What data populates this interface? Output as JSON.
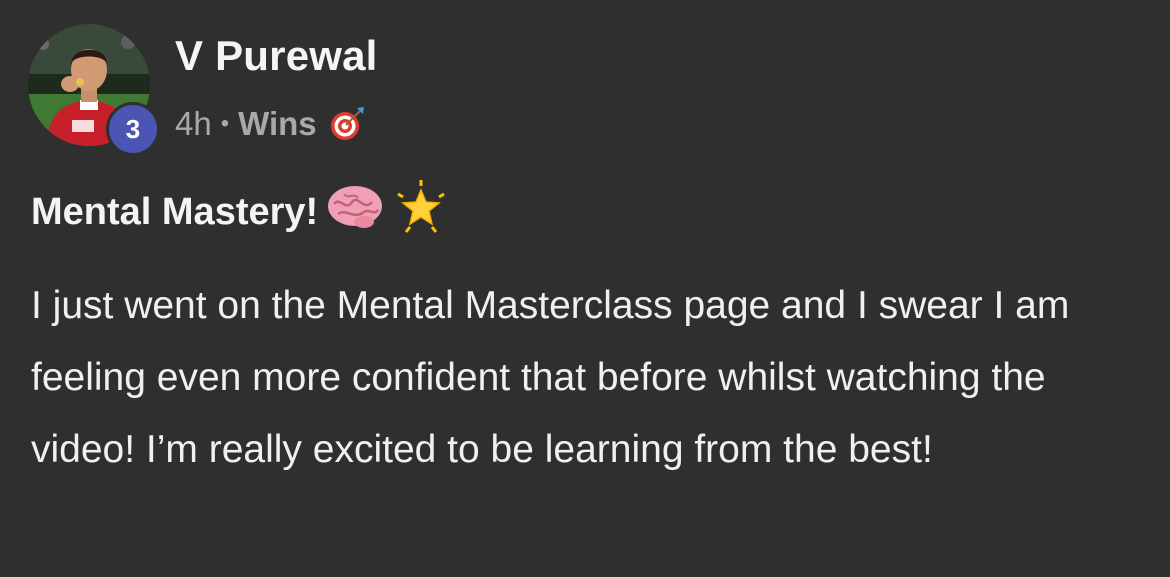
{
  "post": {
    "author": {
      "name": "V Purewal",
      "level": "3"
    },
    "meta": {
      "time": "4h",
      "separator": "•",
      "category": "Wins",
      "category_icon": "direct-hit-target-icon"
    },
    "title": "Mental Mastery!",
    "title_icons": [
      "brain-icon",
      "glowing-star-icon"
    ],
    "body": "I just went on the Mental Masterclass page and I swear I am feeling even more confident that before whilst watching the video! I’m really excited to be learning from the best!"
  },
  "colors": {
    "background": "#2f2f30",
    "text_primary": "#f0f0f0",
    "text_secondary": "#a9a9aa",
    "level_badge": "#4a55b4"
  }
}
